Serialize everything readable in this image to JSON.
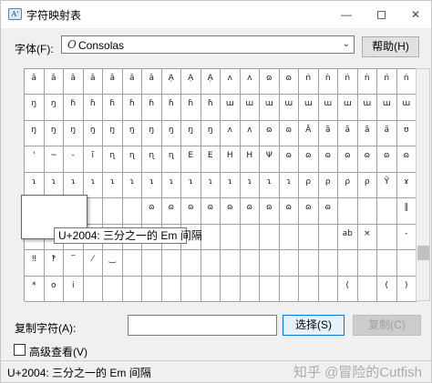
{
  "window": {
    "title": "字符映射表",
    "app_icon": "A'",
    "minimize_label": "—",
    "close_label": "✕"
  },
  "font": {
    "label": "字体(F):",
    "type_icon": "O",
    "value": "Consolas",
    "help_button": "帮助(H)"
  },
  "grid": {
    "rows": [
      [
        "ǎ",
        "ǎ",
        "ǎ",
        "ǎ",
        "ǎ",
        "ǎ",
        "ǎ",
        "Ạ",
        "Ạ",
        "Ạ",
        "ʌ",
        "ʌ",
        "ɷ",
        "ɷ",
        "ṅ",
        "ṅ",
        "ṅ",
        "ṅ",
        "ṅ",
        "ṅ"
      ],
      [
        "ŋ",
        "ŋ",
        "ɦ",
        "ɦ",
        "ɦ",
        "ɦ",
        "ɦ",
        "ɦ",
        "ɦ",
        "ɦ",
        "ɯ",
        "ɯ",
        "ɯ",
        "ɯ",
        "ɯ",
        "ɯ",
        "ɯ",
        "ɯ",
        "ɯ",
        "ɯ"
      ],
      [
        "ŋ",
        "ŋ",
        "ŋ",
        "ŋ",
        "ŋ",
        "ŋ",
        "ŋ",
        "ŋ",
        "ŋ",
        "ŋ",
        "ʌ",
        "ʌ",
        "ɷ",
        "ɷ",
        "Ā",
        "ã",
        "ã",
        "ã",
        "ã",
        "ʊ"
      ],
      [
        "'",
        "~",
        "-",
        "ĩ",
        "ɳ",
        "ɳ",
        "ɳ",
        "ɳ",
        "E",
        "E",
        "H",
        "H",
        "Ψ",
        "ɷ",
        "ɷ",
        "ɷ",
        "ɷ",
        "ɷ",
        "ɷ",
        "ɷ"
      ],
      [
        "ɿ",
        "ɿ",
        "ɿ",
        "ɿ",
        "ɿ",
        "ɿ",
        "ɿ",
        "ɿ",
        "ɿ",
        "ɿ",
        "ɿ",
        "ɿ",
        "ɿ",
        "ɿ",
        "ρ",
        "ρ",
        "ρ",
        "ρ",
        "Ỹ",
        "ɤ"
      ],
      [
        "",
        "",
        "",
        "",
        "",
        "",
        "ɷ",
        "ɷ",
        "ɷ",
        "ɷ",
        "ɷ",
        "ɷ",
        "ɷ",
        "ɷ",
        "ɷ",
        "ɷ",
        "",
        "",
        "",
        "‖"
      ],
      [
        "",
        "",
        "",
        "",
        "",
        "",
        "",
        "",
        "",
        "",
        "",
        "",
        "",
        "",
        "",
        "",
        "ab",
        "×",
        "",
        "‐"
      ],
      [
        "‼",
        "‽",
        "‾",
        "⁄",
        "‿",
        "",
        "",
        "",
        "",
        "",
        "",
        "",
        "",
        "",
        "",
        "",
        "",
        "",
        "",
        ""
      ],
      [
        "*",
        "o",
        "i",
        "",
        "",
        "",
        "",
        "",
        "",
        "",
        "",
        "",
        "",
        "",
        "",
        "",
        "(",
        "",
        "(",
        ")"
      ]
    ]
  },
  "zoom_tooltip": "U+2004: 三分之一的 Em 间隔",
  "copy": {
    "label": "复制字符(A):",
    "value": "",
    "select_button": "选择(S)",
    "copy_button": "复制(C)"
  },
  "advanced": {
    "label": "高级查看(V)",
    "checked": false
  },
  "status": {
    "text": "U+2004: 三分之一的 Em 间隔",
    "watermark": "知乎 @冒险的Cutfish"
  }
}
